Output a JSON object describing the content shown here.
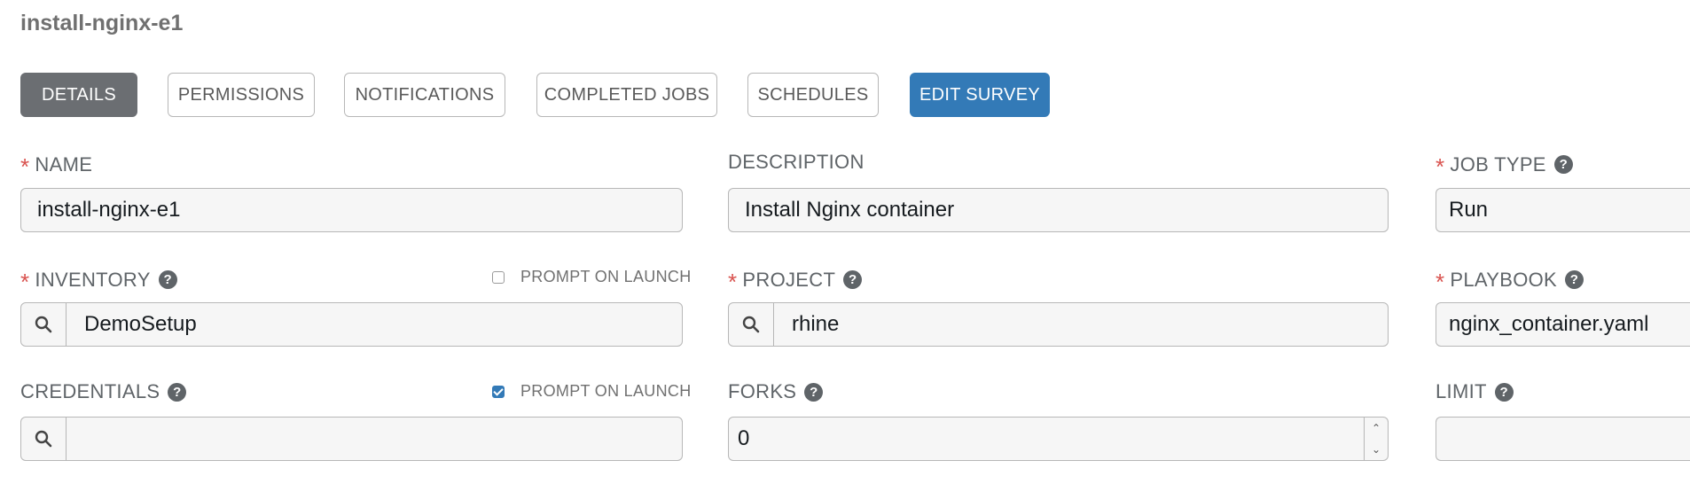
{
  "page_title": "install-nginx-e1",
  "tabs": [
    {
      "label": "DETAILS"
    },
    {
      "label": "PERMISSIONS"
    },
    {
      "label": "NOTIFICATIONS"
    },
    {
      "label": "COMPLETED JOBS"
    },
    {
      "label": "SCHEDULES"
    },
    {
      "label": "EDIT SURVEY"
    }
  ],
  "colors": {
    "active_tab": "#6b6e72",
    "primary_button": "#337ab7",
    "required_asterisk": "#d9534f"
  },
  "required_marker": "*",
  "help_icon_glyph": "?",
  "fields": {
    "name": {
      "label": "NAME",
      "value": "install-nginx-e1"
    },
    "description": {
      "label": "DESCRIPTION",
      "value": "Install Nginx container"
    },
    "job_type": {
      "label": "JOB TYPE",
      "value": "Run"
    },
    "inventory": {
      "label": "INVENTORY",
      "value": "DemoSetup",
      "prompt_label": "PROMPT ON LAUNCH",
      "prompt_checked": false
    },
    "project": {
      "label": "PROJECT",
      "value": "rhine"
    },
    "playbook": {
      "label": "PLAYBOOK",
      "value": "nginx_container.yaml"
    },
    "credentials": {
      "label": "CREDENTIALS",
      "value": "",
      "prompt_label": "PROMPT ON LAUNCH",
      "prompt_checked": true
    },
    "forks": {
      "label": "FORKS",
      "value": "0"
    },
    "limit": {
      "label": "LIMIT",
      "value": ""
    }
  },
  "icons": {
    "lookup": "search-icon",
    "help": "question-circle-icon",
    "spinner_up": "chevron-up-icon",
    "spinner_down": "chevron-down-icon"
  }
}
